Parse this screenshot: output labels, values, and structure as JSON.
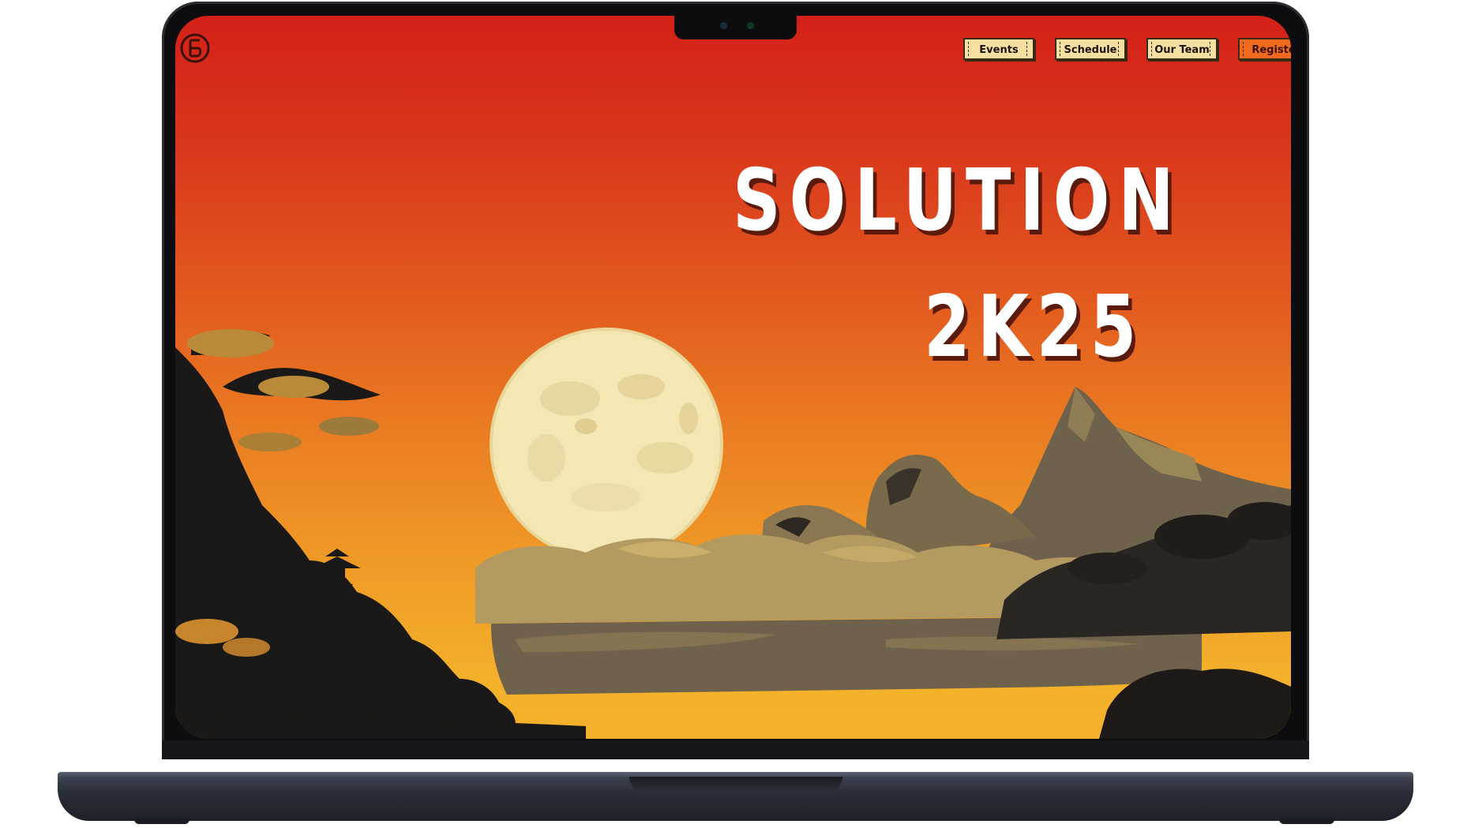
{
  "page": {
    "title_line_1": "SOLUTION",
    "title_line_2": "2K25"
  },
  "nav": {
    "logo_icon": "brand-logo-icon",
    "items": [
      {
        "label": "Events"
      },
      {
        "label": "Schedule"
      },
      {
        "label": "Our Team"
      },
      {
        "label": "Registe"
      }
    ]
  },
  "colors": {
    "sky_top": "#d42018",
    "sky_bottom": "#f5b42b",
    "nav_button_bg": "#f6dfa0",
    "register_button_bg": "#ef6a1d",
    "title_text": "#ffffff",
    "title_shadow": "#5a1a0c",
    "moon": "#f4e7b4"
  },
  "device": {
    "type": "laptop-mockup"
  }
}
